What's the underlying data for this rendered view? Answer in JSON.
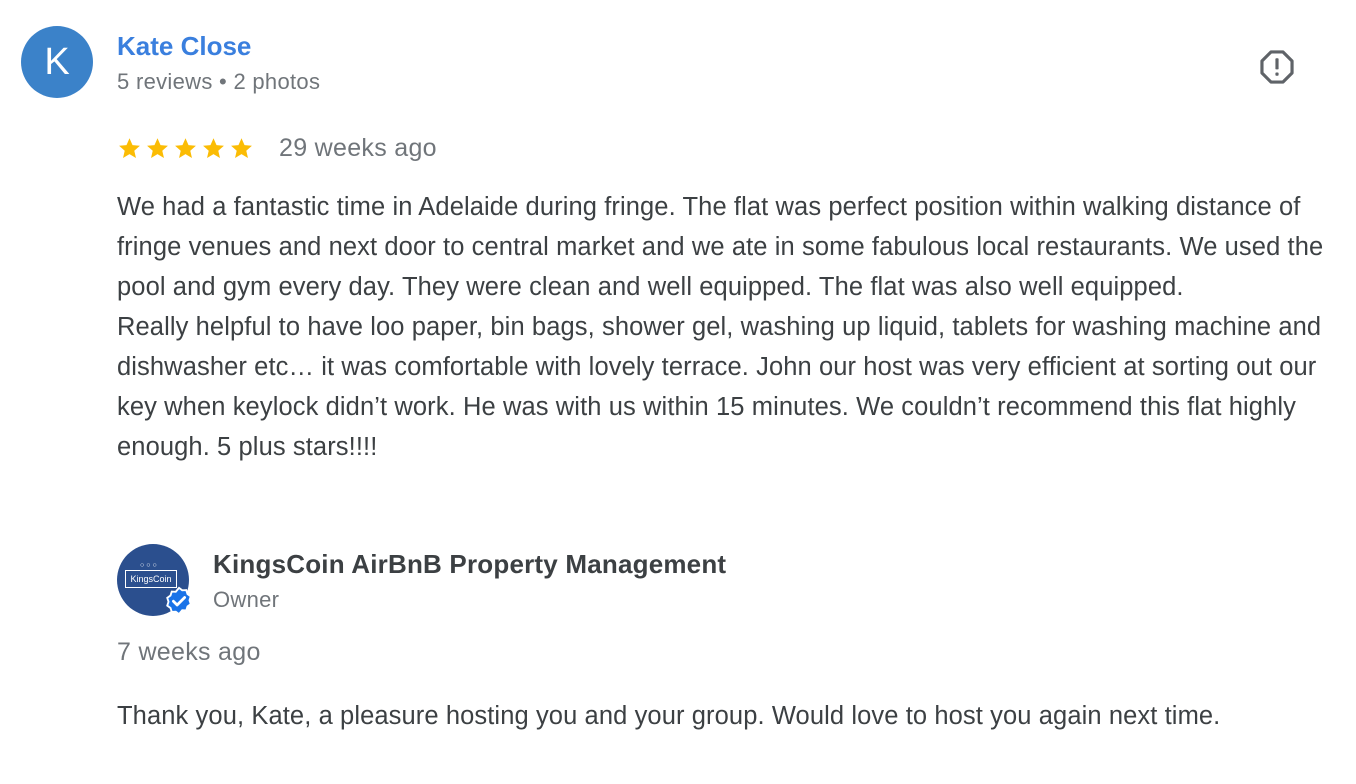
{
  "review": {
    "avatar_letter": "K",
    "avatar_color": "#3b82c9",
    "reviewer_name": "Kate Close",
    "reviewer_meta": "5 reviews • 2 photos",
    "rating": 5,
    "star_color": "#fbbc04",
    "date": "29 weeks ago",
    "text": "We had a fantastic time in Adelaide during fringe. The flat was perfect position within walking distance of fringe venues and next door to central market and we ate in some fabulous local restaurants. We used the pool and gym every day. They were clean and well equipped. The flat was also well equipped.\nReally helpful to have loo paper, bin bags, shower gel, washing up liquid, tablets for washing machine and dishwasher etc… it was comfortable with lovely terrace. John our host was very efficient at sorting out our key when keylock didn’t work. He was with us within 15 minutes. We couldn’t recommend this flat highly enough. 5 plus stars!!!!",
    "report_icon": "report-flag-icon"
  },
  "owner_response": {
    "owner_logo_text": "KingsCoin",
    "owner_name": "KingsCoin AirBnB Property Management",
    "owner_role": "Owner",
    "verified_icon": "verified-check-icon",
    "date": "7 weeks ago",
    "text": "Thank you, Kate, a pleasure hosting you and your group. Would love to host you again next time."
  },
  "colors": {
    "name_link": "#3a7fde",
    "secondary_text": "#70757a",
    "body_text": "#3c4043",
    "owner_avatar_bg": "#2b4f8e",
    "verified_blue": "#1a73e8"
  }
}
